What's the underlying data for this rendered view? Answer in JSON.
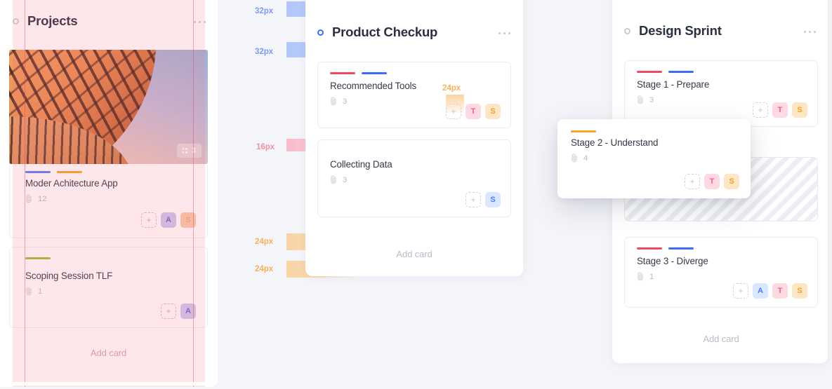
{
  "board": {
    "background_color": "#f4f5f9",
    "columns": [
      {
        "id": "projects",
        "title": "Projects",
        "status_dot": "status-dot-idle",
        "menu_icon": "ellipsis-icon",
        "add_card_label": "Add card",
        "thumbnail": {
          "badge_count": "3",
          "badge_icon": "grid-dots-icon"
        },
        "cards": [
          {
            "title": "Moder Achitecture App",
            "attachments": "12",
            "attachment_icon": "paperclip-icon",
            "tags": [
              "#5b7cfa",
              "#f5a623"
            ],
            "add_member_icon": "plus-icon",
            "avatars": [
              "A",
              "S"
            ]
          },
          {
            "title": "Scoping Session TLF",
            "attachments": "1",
            "attachment_icon": "paperclip-icon",
            "tags": [
              "#a3bd3a"
            ],
            "add_member_icon": "plus-icon",
            "avatars": [
              "A"
            ]
          }
        ]
      },
      {
        "id": "product-checkup",
        "title": "Product Checkup",
        "status_dot": "status-dot-active",
        "menu_icon": "ellipsis-icon",
        "add_card_label": "Add card",
        "cards": [
          {
            "title": "Recommended Tools",
            "attachments": "3",
            "attachment_icon": "paperclip-icon",
            "tags": [
              "#f04a63",
              "#3b6ef6"
            ],
            "add_member_icon": "plus-icon",
            "avatars": [
              "T",
              "S"
            ]
          },
          {
            "title": "Collecting Data",
            "attachments": "3",
            "attachment_icon": "paperclip-icon",
            "tags": [],
            "add_member_icon": "plus-icon",
            "avatars": [
              "S"
            ]
          }
        ]
      },
      {
        "id": "design-sprint",
        "title": "Design Sprint",
        "status_dot": "status-dot-idle",
        "menu_icon": "ellipsis-icon",
        "add_card_label": "Add card",
        "cards": [
          {
            "title": "Stage 1 - Prepare",
            "attachments": "3",
            "attachment_icon": "paperclip-icon",
            "tags": [
              "#f04a63",
              "#3b6ef6"
            ],
            "add_member_icon": "plus-icon",
            "avatars": [
              "T",
              "S"
            ]
          },
          {
            "title": "Stage 3 - Diverge",
            "attachments": "1",
            "attachment_icon": "paperclip-icon",
            "tags": [
              "#f04a63",
              "#3b6ef6"
            ],
            "add_member_icon": "plus-icon",
            "avatars": [
              "A",
              "T",
              "S"
            ]
          }
        ]
      }
    ],
    "dragging_card": {
      "title": "Stage 2 - Understand",
      "attachments": "4",
      "attachment_icon": "paperclip-icon",
      "tags": [
        "#f5a623"
      ],
      "add_member_icon": "plus-icon",
      "avatars": [
        "T",
        "S"
      ]
    },
    "measurements": {
      "spacing_top_1": "32px",
      "spacing_top_2": "32px",
      "spacing_between_cards": "16px",
      "spacing_bottom_1": "24px",
      "spacing_bottom_2": "24px",
      "spacing_avatar": "24px",
      "colors": {
        "blue": "#7d9bf2",
        "pink": "#f58fa8",
        "orange": "#f5b25e",
        "guide_red": "#f43f5e"
      }
    }
  }
}
